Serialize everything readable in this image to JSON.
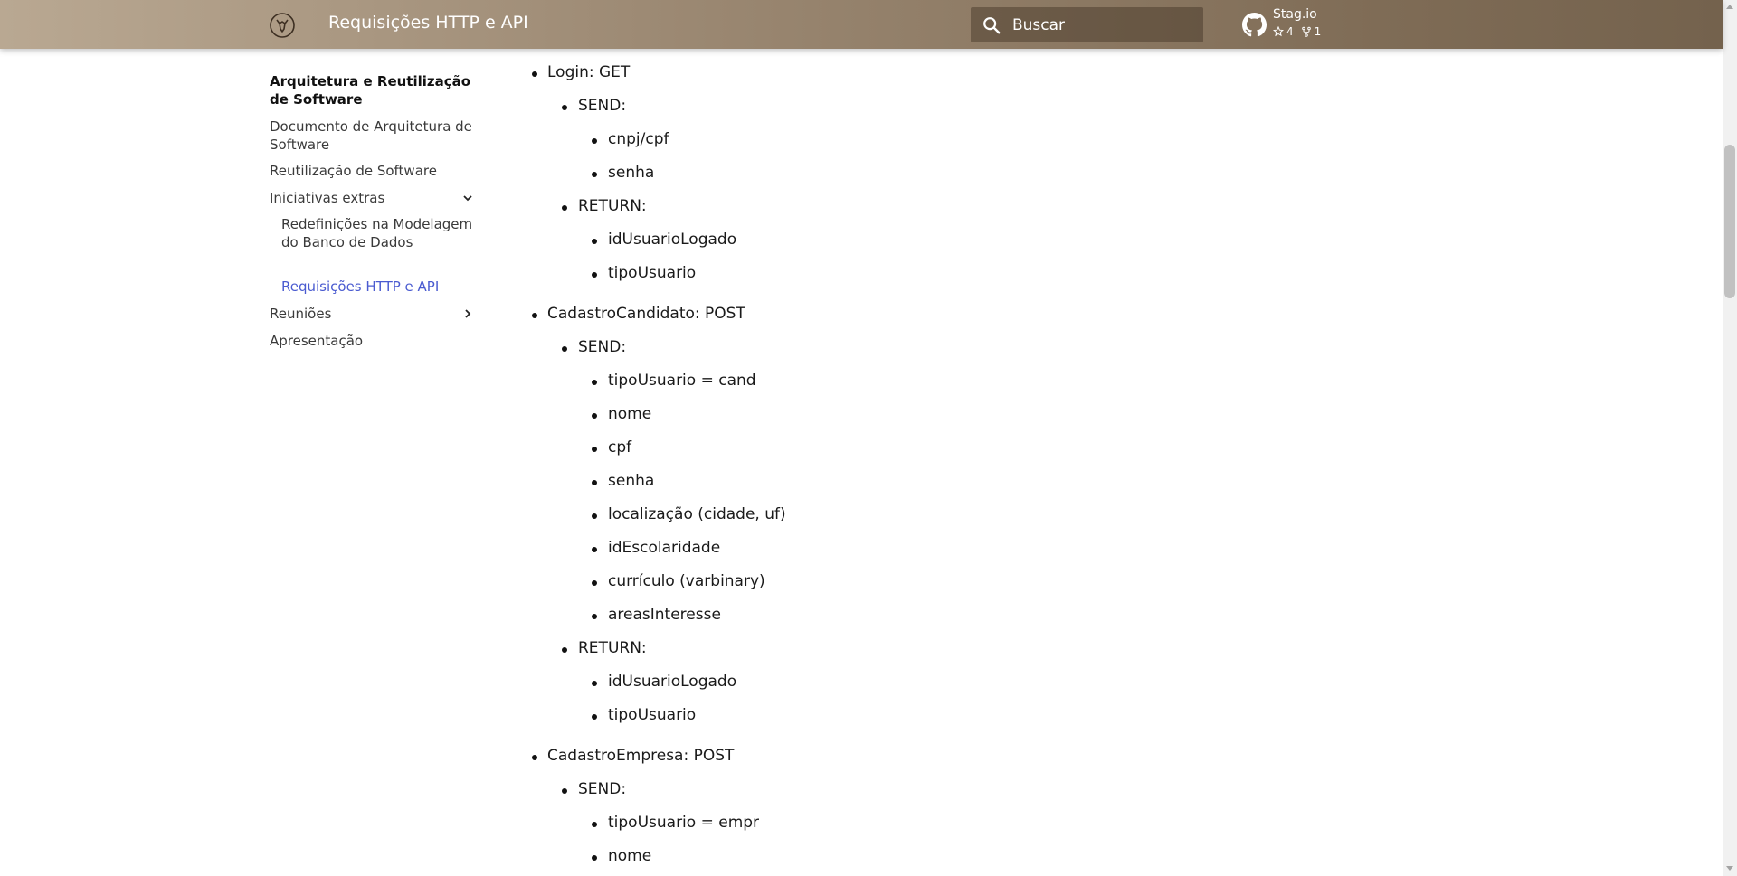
{
  "header": {
    "title": "Requisições HTTP e API",
    "search_placeholder": "Buscar",
    "repo_name": "Stag.io",
    "stars": "4",
    "forks": "1",
    "logo_icon": "logo-icon",
    "colors": {
      "header_start": "#b9a892",
      "header_end": "#74624d",
      "accent": "#4a5bd0"
    }
  },
  "sidebar": {
    "section_title": "Arquitetura e Reutilização de Software",
    "item_doc": "Documento de Arquitetura de Software",
    "item_reuse": "Reutilização de Software",
    "item_extras": "Iniciativas extras",
    "sub_redef": "Redefinições na Modelagem do Banco de Dados",
    "sub_req": "Requisições HTTP e API",
    "item_meetings": "Reuniões",
    "item_presentation": "Apresentação"
  },
  "content": {
    "login": {
      "title": "Login: GET",
      "send": "SEND:",
      "send_items": [
        "cnpj/cpf",
        "senha"
      ],
      "ret": "RETURN:",
      "return_items": [
        "idUsuarioLogado",
        "tipoUsuario"
      ]
    },
    "cand": {
      "title": "CadastroCandidato: POST",
      "send": "SEND:",
      "send_items": [
        "tipoUsuario = cand",
        "nome",
        "cpf",
        "senha",
        "localização (cidade, uf)",
        "idEscolaridade",
        "currículo (varbinary)",
        "areasInteresse"
      ],
      "ret": "RETURN:",
      "return_items": [
        "idUsuarioLogado",
        "tipoUsuario"
      ]
    },
    "emp": {
      "title": "CadastroEmpresa: POST",
      "send": "SEND:",
      "send_items": [
        "tipoUsuario = empr",
        "nome"
      ]
    }
  }
}
